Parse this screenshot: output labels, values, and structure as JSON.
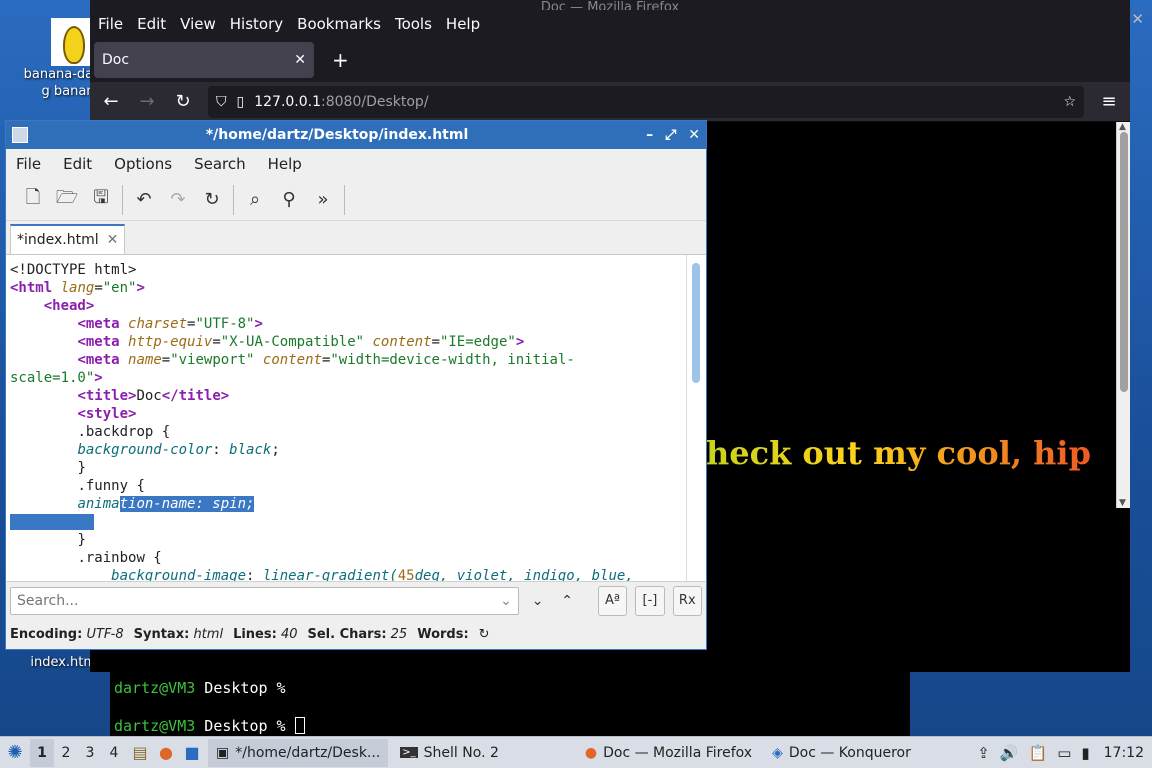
{
  "desktop": {
    "icons": [
      {
        "label": "banana-dancing banana"
      },
      {
        "label": "index.html"
      }
    ]
  },
  "firefox": {
    "window_title": "Doc — Mozilla Firefox",
    "menu": [
      "File",
      "Edit",
      "View",
      "History",
      "Bookmarks",
      "Tools",
      "Help"
    ],
    "tab_title": "Doc",
    "url_host": "127.0.0.1",
    "url_rest": ":8080/Desktop/",
    "page_text": "heck out my cool, hip"
  },
  "terminal": {
    "prompt_user": "dartz@VM3",
    "prompt_rest": " Desktop % ",
    "lines": [
      "",
      ""
    ]
  },
  "editor": {
    "title": "*/home/dartz/Desktop/index.html",
    "menu": [
      "File",
      "Edit",
      "Options",
      "Search",
      "Help"
    ],
    "tab_label": "*index.html",
    "search_placeholder": "Search...",
    "status": {
      "encoding_label": "Encoding:",
      "encoding": "UTF-8",
      "syntax_label": "Syntax:",
      "syntax": "html",
      "lines_label": "Lines:",
      "lines": "40",
      "sel_label": "Sel. Chars:",
      "sel": "25",
      "words_label": "Words:"
    },
    "code": {
      "l1": "<!DOCTYPE html>",
      "l2_tag": "<html",
      "l2_attr": "lang",
      "l2_eq": "=",
      "l2_str": "\"en\"",
      "l2_end": ">",
      "l3": "<head>",
      "l4_tag": "<meta",
      "l4_attr": "charset",
      "l4_str": "\"UTF-8\"",
      "l5_attr1": "http-equiv",
      "l5_str1": "\"X-UA-Compatible\"",
      "l5_attr2": "content",
      "l5_str2": "\"IE=edge\"",
      "l6_attr1": "name",
      "l6_str1": "\"viewport\"",
      "l6_attr2": "content",
      "l6_str2a": "\"width=device-width, initial-",
      "l7_str": "scale=1.0\"",
      "l8_open": "<title>",
      "l8_text": "Doc",
      "l8_close": "</title>",
      "l9": "<style>",
      "l10": ".backdrop {",
      "l11_prop": "background-color",
      "l11_val": "black",
      "l12": "}",
      "l13": ".funny {",
      "l14_pre": "anima",
      "l14_sel": "tion-name: spin;",
      "l16": "}",
      "l17": ".rainbow {",
      "l18_prop": "background-image",
      "l18_fn": "linear-gradient(",
      "l18_num": "45",
      "l18_rest": "deg, violet, indigo, blue,"
    }
  },
  "taskbar": {
    "workspaces": [
      "1",
      "2",
      "3",
      "4"
    ],
    "tasks": [
      {
        "label": "*/home/dartz/Desk..."
      },
      {
        "label": "Shell No. 2"
      },
      {
        "label": "Doc — Mozilla Firefox"
      },
      {
        "label": "Doc — Konqueror"
      }
    ],
    "clock": "17:12"
  }
}
